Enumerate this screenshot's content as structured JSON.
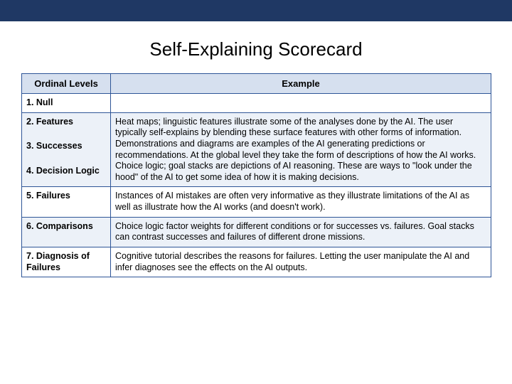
{
  "title": "Self-Explaining Scorecard",
  "headers": {
    "ordinal": "Ordinal Levels",
    "example": "Example"
  },
  "rows": {
    "r1": {
      "label": "1. Null",
      "example": ""
    },
    "r2": {
      "label": "2. Features"
    },
    "r3": {
      "label": "3. Successes"
    },
    "r4": {
      "label": "4. Decision Logic"
    },
    "merged_example": "Heat maps; linguistic features illustrate some of the analyses done by the AI. The user typically self-explains by blending these surface features with other forms of information.\nDemonstrations and diagrams are examples of the AI generating predictions or recommendations. At the global level they take the form of descriptions of how the AI works.\nChoice logic; goal stacks are depictions of AI reasoning. These are ways to \"look under the hood\" of the AI to get some idea of how it is making decisions.",
    "r5": {
      "label": "5. Failures",
      "example": "Instances of AI mistakes are often very informative as they illustrate limitations of the AI as well as illustrate how the AI works (and doesn't work)."
    },
    "r6": {
      "label": "6. Comparisons",
      "example": "Choice logic factor weights for different conditions or for successes vs. failures. Goal stacks can contrast successes and failures of different drone missions."
    },
    "r7": {
      "label": "7. Diagnosis of Failures",
      "example": "Cognitive tutorial describes the reasons for failures. Letting the user manipulate the AI and infer diagnoses see the effects on the AI outputs."
    }
  }
}
